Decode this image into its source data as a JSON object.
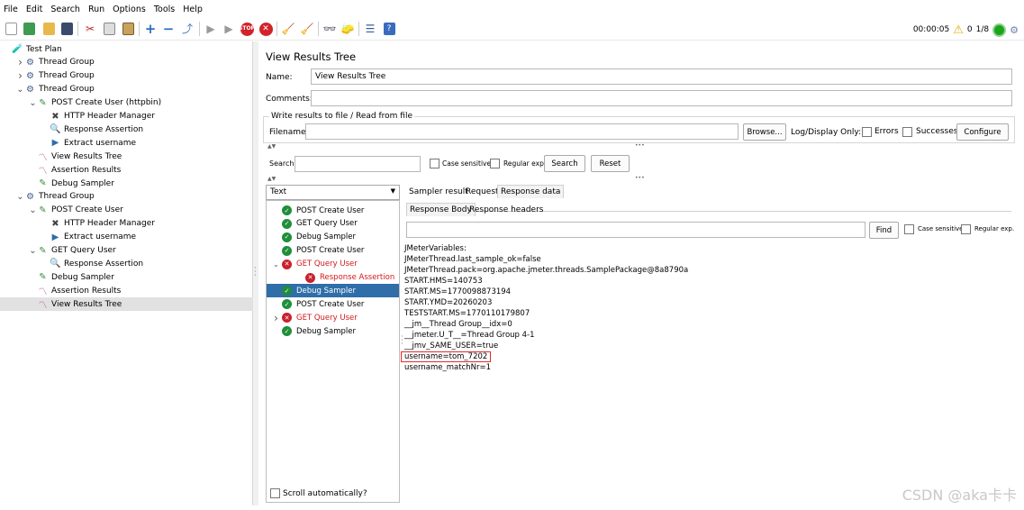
{
  "menu": [
    "File",
    "Edit",
    "Search",
    "Run",
    "Options",
    "Tools",
    "Help"
  ],
  "toolbar": {
    "icons": [
      "new-icon",
      "templates-icon",
      "open-icon",
      "save-icon",
      "cut-icon",
      "copy-icon",
      "paste-icon",
      "expand-icon",
      "collapse-icon",
      "toggle-icon",
      "start-icon",
      "start-no-pause-icon",
      "stop-icon",
      "shutdown-icon",
      "clear-icon",
      "clear-all-icon",
      "search-icon",
      "reset-search-icon",
      "function-helper-icon",
      "help-icon"
    ],
    "elapsed_time": "00:00:05",
    "warning_count": "0",
    "threads": "1/8"
  },
  "tree": [
    {
      "label": "Test Plan",
      "icon": "test-plan-icon",
      "indent": 0,
      "chev": "",
      "selected": false
    },
    {
      "label": "Thread Group",
      "icon": "thread-group-icon",
      "indent": 1,
      "chev": ">",
      "selected": false
    },
    {
      "label": "Thread Group",
      "icon": "thread-group-icon",
      "indent": 1,
      "chev": ">",
      "selected": false
    },
    {
      "label": "Thread Group",
      "icon": "thread-group-icon",
      "indent": 1,
      "chev": "v",
      "selected": false
    },
    {
      "label": "POST Create User (httpbin)",
      "icon": "sampler-icon",
      "indent": 2,
      "chev": "v",
      "selected": false
    },
    {
      "label": "HTTP Header Manager",
      "icon": "config-icon",
      "indent": 3,
      "chev": "",
      "selected": false
    },
    {
      "label": "Response Assertion",
      "icon": "assertion-icon",
      "indent": 3,
      "chev": "",
      "selected": false
    },
    {
      "label": "Extract username",
      "icon": "extractor-icon",
      "indent": 3,
      "chev": "",
      "selected": false
    },
    {
      "label": "View Results Tree",
      "icon": "listener-icon",
      "indent": 2,
      "chev": "",
      "selected": false
    },
    {
      "label": "Assertion Results",
      "icon": "listener-icon",
      "indent": 2,
      "chev": "",
      "selected": false
    },
    {
      "label": "Debug Sampler",
      "icon": "sampler-icon",
      "indent": 2,
      "chev": "",
      "selected": false
    },
    {
      "label": "Thread Group",
      "icon": "thread-group-icon",
      "indent": 1,
      "chev": "v",
      "selected": false
    },
    {
      "label": "POST Create User",
      "icon": "sampler-icon",
      "indent": 2,
      "chev": "v",
      "selected": false
    },
    {
      "label": "HTTP Header Manager",
      "icon": "config-icon",
      "indent": 3,
      "chev": "",
      "selected": false
    },
    {
      "label": "Extract username",
      "icon": "extractor-icon",
      "indent": 3,
      "chev": "",
      "selected": false
    },
    {
      "label": "GET Query User",
      "icon": "sampler-icon",
      "indent": 2,
      "chev": "v",
      "selected": false
    },
    {
      "label": "Response Assertion",
      "icon": "assertion-icon",
      "indent": 3,
      "chev": "",
      "selected": false
    },
    {
      "label": "Debug Sampler",
      "icon": "sampler-icon",
      "indent": 2,
      "chev": "",
      "selected": false
    },
    {
      "label": "Assertion Results",
      "icon": "listener-icon",
      "indent": 2,
      "chev": "",
      "selected": false
    },
    {
      "label": "View Results Tree",
      "icon": "listener-icon",
      "indent": 2,
      "chev": "",
      "selected": true
    }
  ],
  "panel": {
    "title": "View Results Tree",
    "name_label": "Name:",
    "name_value": "View Results Tree",
    "comments_label": "Comments:",
    "comments_value": "",
    "write_results_label": "Write results to file / Read from file",
    "filename_label": "Filename",
    "filename_value": "",
    "browse_label": "Browse...",
    "log_display_label": "Log/Display Only:",
    "errors_label": "Errors",
    "successes_label": "Successes",
    "configure_label": "Configure",
    "search_label": "Search:",
    "search_value": "",
    "case_sensitive_label": "Case sensitive",
    "regular_exp_label": "Regular exp.",
    "search_button": "Search",
    "reset_button": "Reset",
    "renderer": "Text",
    "scroll_auto_label": "Scroll automatically?"
  },
  "results": [
    {
      "label": "POST Create User",
      "status": "ok",
      "indent": 0,
      "chev": "",
      "error": false,
      "selected": false
    },
    {
      "label": "GET Query User",
      "status": "ok",
      "indent": 0,
      "chev": "",
      "error": false,
      "selected": false
    },
    {
      "label": "Debug Sampler",
      "status": "ok",
      "indent": 0,
      "chev": "",
      "error": false,
      "selected": false
    },
    {
      "label": "POST Create User",
      "status": "ok",
      "indent": 0,
      "chev": "",
      "error": false,
      "selected": false
    },
    {
      "label": "GET Query User",
      "status": "err",
      "indent": 0,
      "chev": "v",
      "error": true,
      "selected": false
    },
    {
      "label": "Response Assertion",
      "status": "err",
      "indent": 1,
      "chev": "",
      "error": true,
      "selected": false
    },
    {
      "label": "Debug Sampler",
      "status": "ok",
      "indent": 0,
      "chev": "",
      "error": false,
      "selected": true
    },
    {
      "label": "POST Create User",
      "status": "ok",
      "indent": 0,
      "chev": "",
      "error": false,
      "selected": false
    },
    {
      "label": "GET Query User",
      "status": "err",
      "indent": 0,
      "chev": ">",
      "error": true,
      "selected": false
    },
    {
      "label": "Debug Sampler",
      "status": "ok",
      "indent": 0,
      "chev": "",
      "error": false,
      "selected": false
    }
  ],
  "tabs": {
    "main": [
      "Sampler result",
      "Request",
      "Response data"
    ],
    "sub": [
      "Response Body",
      "Response headers"
    ],
    "find_button": "Find",
    "case_sensitive_label": "Case sensitive",
    "regular_exp_label": "Regular exp."
  },
  "response_lines": [
    "JMeterVariables:",
    "JMeterThread.last_sample_ok=false",
    "JMeterThread.pack=org.apache.jmeter.threads.SamplePackage@8a8790a",
    "START.HMS=140753",
    "START.MS=1770098873194",
    "START.YMD=20260203",
    "TESTSTART.MS=1770110179807",
    "__jm__Thread Group__idx=0",
    "__jmeter.U_T__=Thread Group 4-1",
    "__jmv_SAME_USER=true",
    "username=tom_7202",
    "username_matchNr=1"
  ],
  "highlighted_line": "username=tom_7202",
  "watermark": "CSDN @aka卡卡",
  "colors": {
    "selection": "#2f6ea8",
    "error": "#d11a1a",
    "success": "#1e8f3a",
    "highlight_border": "#e02b2b"
  }
}
